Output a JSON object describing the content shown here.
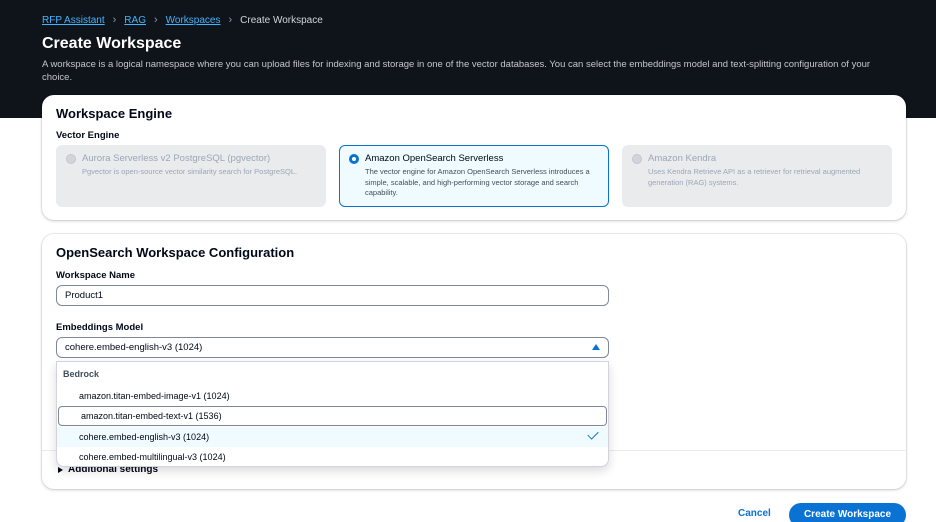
{
  "breadcrumb": {
    "items": [
      "RFP Assistant",
      "RAG",
      "Workspaces"
    ],
    "current": "Create Workspace"
  },
  "header": {
    "title": "Create Workspace",
    "description": "A workspace is a logical namespace where you can upload files for indexing and storage in one of the vector databases. You can select the embeddings model and text-splitting configuration of your choice."
  },
  "engine": {
    "title": "Workspace Engine",
    "label": "Vector Engine",
    "options": [
      {
        "name": "Aurora Serverless v2 PostgreSQL (pgvector)",
        "desc": "Pgvector is open-source vector similarity search for PostgreSQL.",
        "state": "disabled"
      },
      {
        "name": "Amazon OpenSearch Serverless",
        "desc": "The vector engine for Amazon OpenSearch Serverless introduces a simple, scalable, and high-performing vector storage and search capability.",
        "state": "selected"
      },
      {
        "name": "Amazon Kendra",
        "desc": "Uses Kendra Retrieve API as a retriever for retrieval augmented generation (RAG) systems.",
        "state": "disabled"
      }
    ]
  },
  "config": {
    "title": "OpenSearch Workspace Configuration",
    "name_label": "Workspace Name",
    "name_value": "Product1",
    "model_label": "Embeddings Model",
    "model_value": "cohere.embed-english-v3 (1024)",
    "dropdown": {
      "group": "Bedrock",
      "options": [
        "amazon.titan-embed-image-v1 (1024)",
        "amazon.titan-embed-text-v1 (1536)",
        "cohere.embed-english-v3 (1024)",
        "cohere.embed-multilingual-v3 (1024)"
      ],
      "selected_index": 2,
      "hover_index": 1
    },
    "additional": "Additional settings"
  },
  "actions": {
    "cancel": "Cancel",
    "submit": "Create Workspace"
  },
  "colors": {
    "header_bg": "#0f141a",
    "accent": "#0972d3",
    "link_dark": "#42b4ff"
  }
}
